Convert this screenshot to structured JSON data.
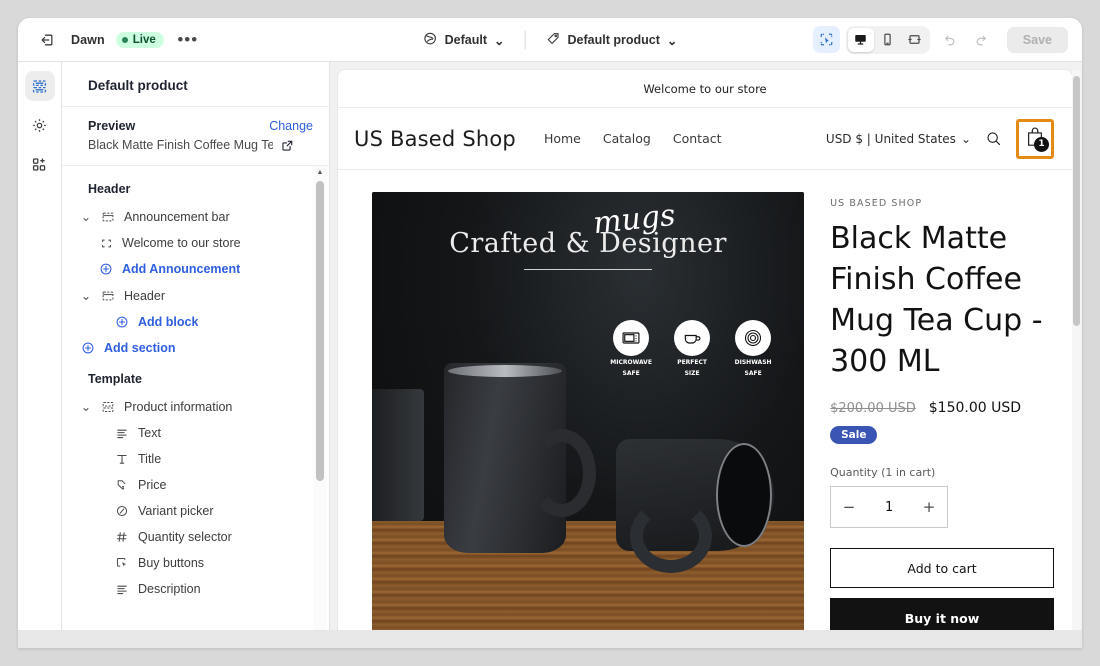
{
  "topbar": {
    "exit_icon": "exit-icon",
    "theme_name": "Dawn",
    "status_label": "Live",
    "more_label": "•••",
    "store_selector": {
      "icon": "globe-icon",
      "label": "Default",
      "chevron": "⌄"
    },
    "template_selector": {
      "icon": "tag-icon",
      "label": "Default product",
      "chevron": "⌄"
    },
    "inspector_icon": "inspector-icon",
    "devices": [
      {
        "name": "desktop",
        "icon": "desktop-icon",
        "selected": true
      },
      {
        "name": "mobile",
        "icon": "mobile-icon",
        "selected": false
      },
      {
        "name": "fullwidth",
        "icon": "fullwidth-icon",
        "selected": false
      }
    ],
    "undo_icon": "undo-icon",
    "redo_icon": "redo-icon",
    "save_label": "Save"
  },
  "rail": [
    {
      "name": "sections-icon",
      "active": true
    },
    {
      "name": "gear-icon",
      "active": false
    },
    {
      "name": "apps-icon",
      "active": false
    }
  ],
  "sidebar": {
    "title": "Default product",
    "preview_label": "Preview",
    "change_label": "Change",
    "preview_product": "Black Matte Finish Coffee Mug Te...",
    "external_icon": "external-link-icon",
    "header_group": "Header",
    "template_group": "Template",
    "tree_header": [
      {
        "label": "Announcement bar",
        "icon": "section-icon",
        "indent": 0,
        "caret": "⌄",
        "link": false
      },
      {
        "label": "Welcome to our store",
        "icon": "block-icon",
        "indent": 1,
        "caret": "",
        "link": false
      },
      {
        "label": "Add Announcement",
        "icon": "plus-circle-icon",
        "indent": 1,
        "caret": "",
        "link": true
      },
      {
        "label": "Header",
        "icon": "section-icon",
        "indent": 0,
        "caret": "⌄",
        "link": false
      },
      {
        "label": "Add block",
        "icon": "plus-circle-icon",
        "indent": 1,
        "caret": "",
        "link": true
      },
      {
        "label": "Add section",
        "icon": "plus-circle-icon",
        "indent": 0,
        "caret": "",
        "link": true
      }
    ],
    "tree_template": [
      {
        "label": "Product information",
        "icon": "section-icon",
        "indent": 0,
        "caret": "⌄",
        "link": false
      },
      {
        "label": "Text",
        "icon": "text-icon",
        "indent": 1,
        "caret": "",
        "link": false
      },
      {
        "label": "Title",
        "icon": "title-icon",
        "indent": 1,
        "caret": "",
        "link": false
      },
      {
        "label": "Price",
        "icon": "price-icon",
        "indent": 1,
        "caret": "",
        "link": false
      },
      {
        "label": "Variant picker",
        "icon": "variant-icon",
        "indent": 1,
        "caret": "",
        "link": false
      },
      {
        "label": "Quantity selector",
        "icon": "hash-icon",
        "indent": 1,
        "caret": "",
        "link": false
      },
      {
        "label": "Buy buttons",
        "icon": "buy-button-icon",
        "indent": 1,
        "caret": "",
        "link": false
      },
      {
        "label": "Description",
        "icon": "text-icon",
        "indent": 1,
        "caret": "",
        "link": false
      }
    ]
  },
  "preview": {
    "announcement": "Welcome to our store",
    "store_logo": "US Based Shop",
    "nav": [
      "Home",
      "Catalog",
      "Contact"
    ],
    "currency": "USD $ | United States",
    "currency_chevron": "⌄",
    "search_icon": "search-icon",
    "cart_icon": "shopping-bag-icon",
    "cart_count": "1",
    "cart_highlight_color": "#e58b13",
    "gallery": {
      "headline": "Crafted & Designer",
      "script_word": "mugs",
      "badges": [
        {
          "icon": "microwave-icon",
          "line1": "MICROWAVE",
          "line2": "SAFE"
        },
        {
          "icon": "cup-icon",
          "line1": "PERFECT",
          "line2": "SIZE"
        },
        {
          "icon": "dishwasher-icon",
          "line1": "DISHWASH",
          "line2": "SAFE"
        }
      ]
    },
    "product": {
      "vendor": "US BASED SHOP",
      "title": "Black Matte Finish Coffee Mug Tea Cup - 300 ML",
      "compare_price": "$200.00 USD",
      "price": "$150.00 USD",
      "sale_badge": "Sale",
      "sale_badge_color": "#3a55b4",
      "quantity_label": "Quantity (1 in cart)",
      "quantity_minus": "−",
      "quantity_value": "1",
      "quantity_plus": "+",
      "add_to_cart_label": "Add to cart",
      "buy_now_label": "Buy it now"
    }
  }
}
